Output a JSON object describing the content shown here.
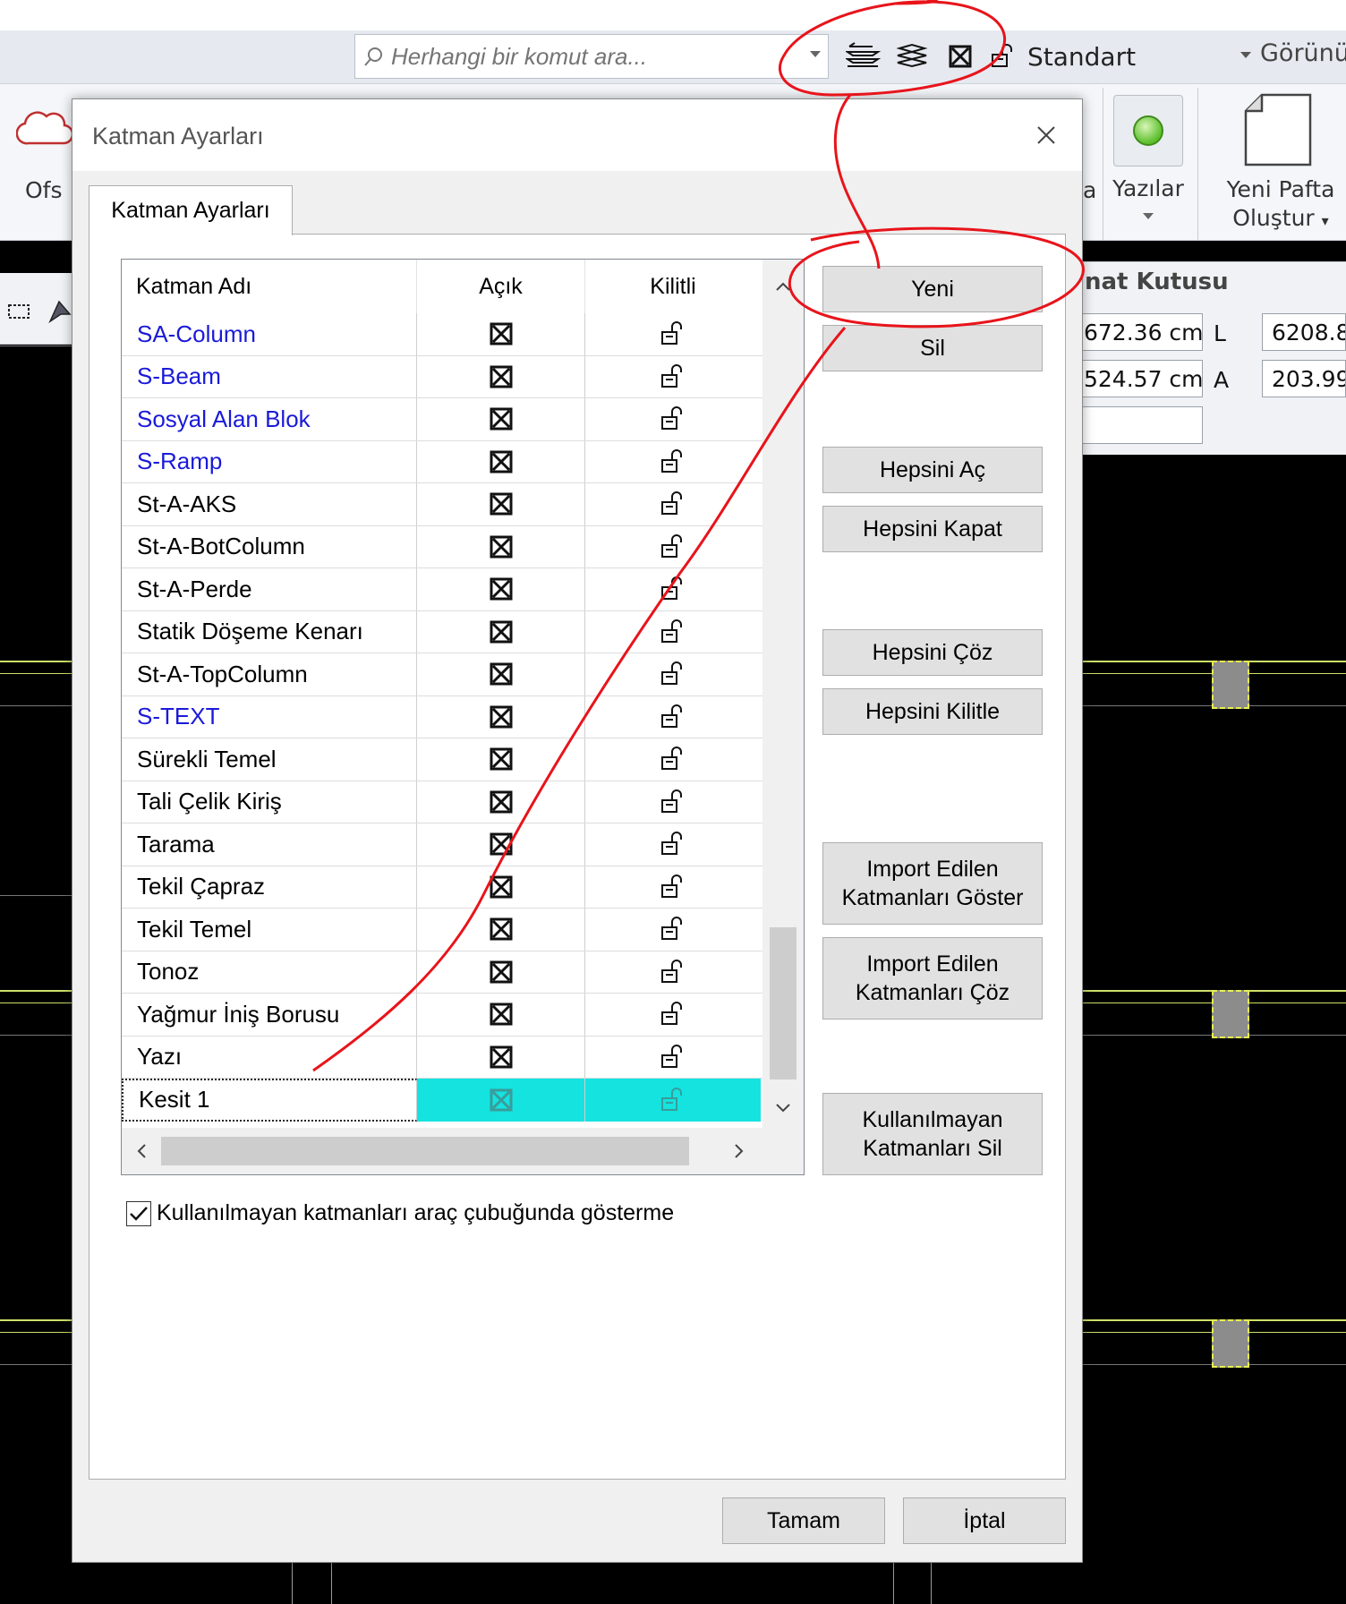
{
  "app": {
    "command_search": {
      "placeholder": "Herhangi bir komut ara..."
    },
    "layer_combo": {
      "value": "Standart"
    },
    "view_label": "Görünü",
    "ribbon": {
      "ofset_label": "Ofs",
      "a_label": "a",
      "yazilar_label": "Yazılar",
      "yeni_pafta_line1": "Yeni Pafta",
      "yeni_pafta_line2": "Oluştur"
    },
    "properties": {
      "title": "nat Kutusu",
      "field1": "672.36 cm",
      "label1": "L",
      "field2": "6208.8",
      "field3": "524.57 cm",
      "label2": "A",
      "field4": "203.99"
    }
  },
  "dialog": {
    "title": "Katman Ayarları",
    "tab": "Katman Ayarları",
    "grid": {
      "headers": {
        "name": "Katman Adı",
        "open": "Açık",
        "lock": "Kilitli"
      },
      "rows": [
        {
          "name": "SA-Column",
          "color": "blue",
          "open": true,
          "locked": false
        },
        {
          "name": "S-Beam",
          "color": "blue",
          "open": true,
          "locked": false
        },
        {
          "name": "Sosyal Alan Blok",
          "color": "blue",
          "open": true,
          "locked": false
        },
        {
          "name": "S-Ramp",
          "color": "blue",
          "open": true,
          "locked": false
        },
        {
          "name": "St-A-AKS",
          "color": "black",
          "open": true,
          "locked": false
        },
        {
          "name": "St-A-BotColumn",
          "color": "black",
          "open": true,
          "locked": false
        },
        {
          "name": "St-A-Perde",
          "color": "black",
          "open": true,
          "locked": false
        },
        {
          "name": "Statik Döşeme Kenarı",
          "color": "black",
          "open": true,
          "locked": false
        },
        {
          "name": "St-A-TopColumn",
          "color": "black",
          "open": true,
          "locked": false
        },
        {
          "name": "S-TEXT",
          "color": "blue",
          "open": true,
          "locked": false
        },
        {
          "name": "Sürekli Temel",
          "color": "black",
          "open": true,
          "locked": false
        },
        {
          "name": "Tali Çelik Kiriş",
          "color": "black",
          "open": true,
          "locked": false
        },
        {
          "name": "Tarama",
          "color": "black",
          "open": true,
          "locked": false
        },
        {
          "name": "Tekil Çapraz",
          "color": "black",
          "open": true,
          "locked": false
        },
        {
          "name": "Tekil Temel",
          "color": "black",
          "open": true,
          "locked": false
        },
        {
          "name": "Tonoz",
          "color": "black",
          "open": true,
          "locked": false
        },
        {
          "name": "Yağmur İniş Borusu",
          "color": "black",
          "open": true,
          "locked": false
        },
        {
          "name": "Yazı",
          "color": "black",
          "open": true,
          "locked": false
        },
        {
          "name": "Kesit 1",
          "color": "black",
          "open": true,
          "locked": false,
          "selected": true
        }
      ]
    },
    "buttons": {
      "yeni": "Yeni",
      "sil": "Sil",
      "hepsini_ac": "Hepsini Aç",
      "hepsini_kapat": "Hepsini Kapat",
      "hepsini_coz": "Hepsini Çöz",
      "hepsini_kilitle": "Hepsini Kilitle",
      "import_goster_1": "Import Edilen",
      "import_goster_2": "Katmanları Göster",
      "import_coz_1": "Import Edilen",
      "import_coz_2": "Katmanları Çöz",
      "kullanilmayan_sil_1": "Kullanılmayan",
      "kullanilmayan_sil_2": "Katmanları Sil",
      "tamam": "Tamam",
      "iptal": "İptal"
    },
    "checkbox": {
      "label": "Kullanılmayan katmanları araç çubuğunda gösterme",
      "checked": true
    }
  },
  "colors": {
    "selected_row": "#14e3e0",
    "blue_layer_text": "#1a1ad8",
    "annotation_red": "#e8141b",
    "cad_line": "#cfe06a"
  }
}
